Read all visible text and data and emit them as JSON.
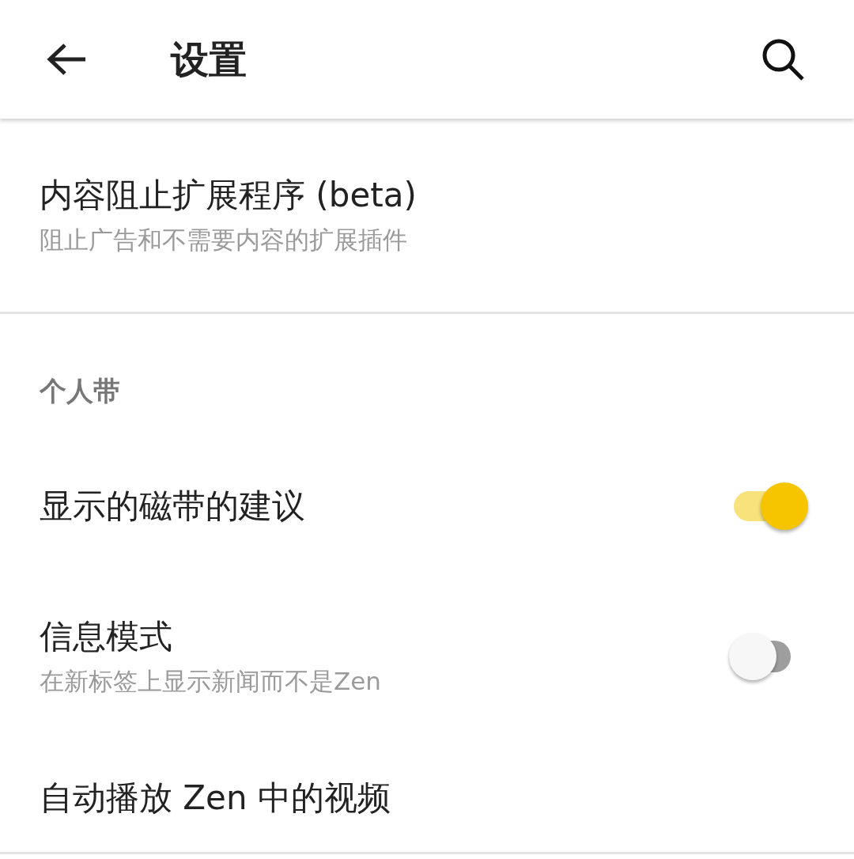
{
  "header": {
    "title": "设置"
  },
  "items": [
    {
      "kind": "link",
      "title": "内容阻止扩展程序 (beta)",
      "subtitle": "阻止广告和不需要内容的扩展插件"
    },
    {
      "kind": "section",
      "title": "个人带"
    },
    {
      "kind": "toggle",
      "title": "显示的磁带的建议",
      "on": true
    },
    {
      "kind": "toggle",
      "title": "信息模式",
      "subtitle": "在新标签上显示新闻而不是Zen",
      "on": false
    },
    {
      "kind": "link",
      "title": "自动播放 Zen 中的视频"
    }
  ]
}
